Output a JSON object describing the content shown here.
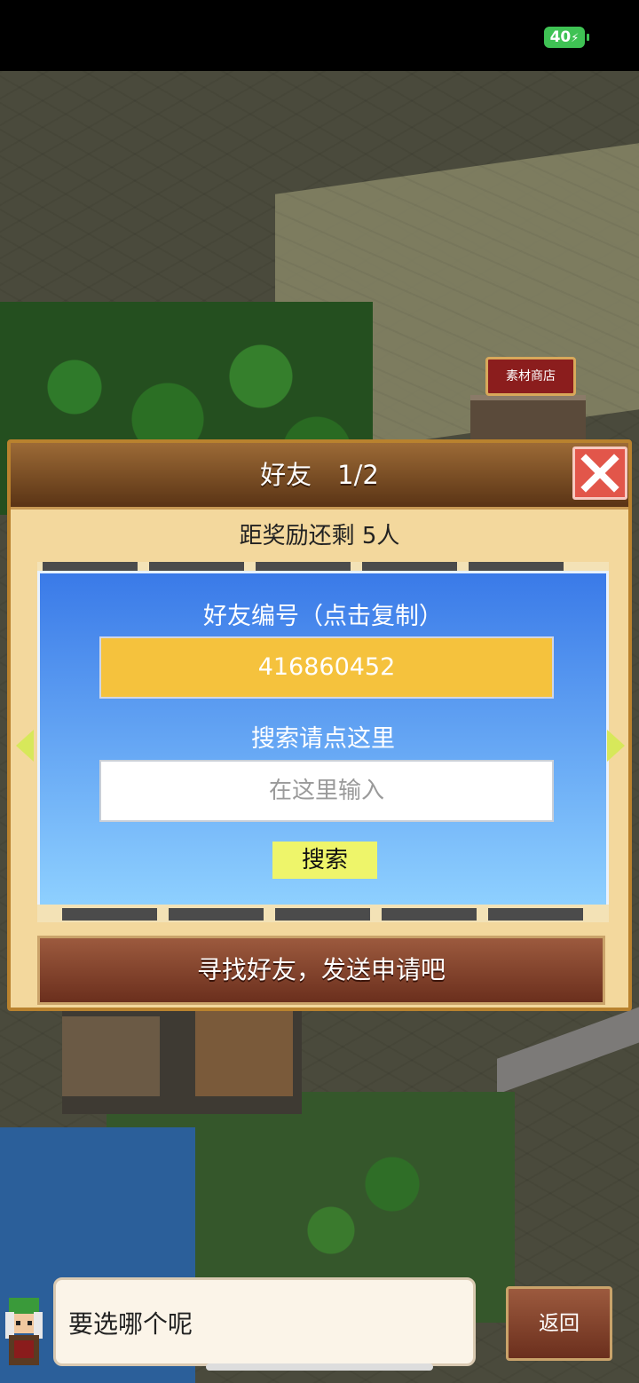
{
  "status_bar": {
    "battery": "40"
  },
  "map": {
    "material_shop_sign": "素材商店"
  },
  "dialog": {
    "title": "好友　1/2",
    "reward_text": "距奖励还剩 5人",
    "friend_id_label": "好友编号（点击复制）",
    "friend_id": "416860452",
    "search_label": "搜索请点这里",
    "search_placeholder": "在这里输入",
    "search_button": "搜索",
    "find_friends_button": "寻找好友，发送申请吧"
  },
  "speech": {
    "text": "要选哪个呢",
    "back_button": "返回"
  },
  "icons": [
    "battery-charging-icon",
    "close-icon",
    "arrow-left-icon",
    "arrow-right-icon",
    "character-avatar-icon"
  ]
}
